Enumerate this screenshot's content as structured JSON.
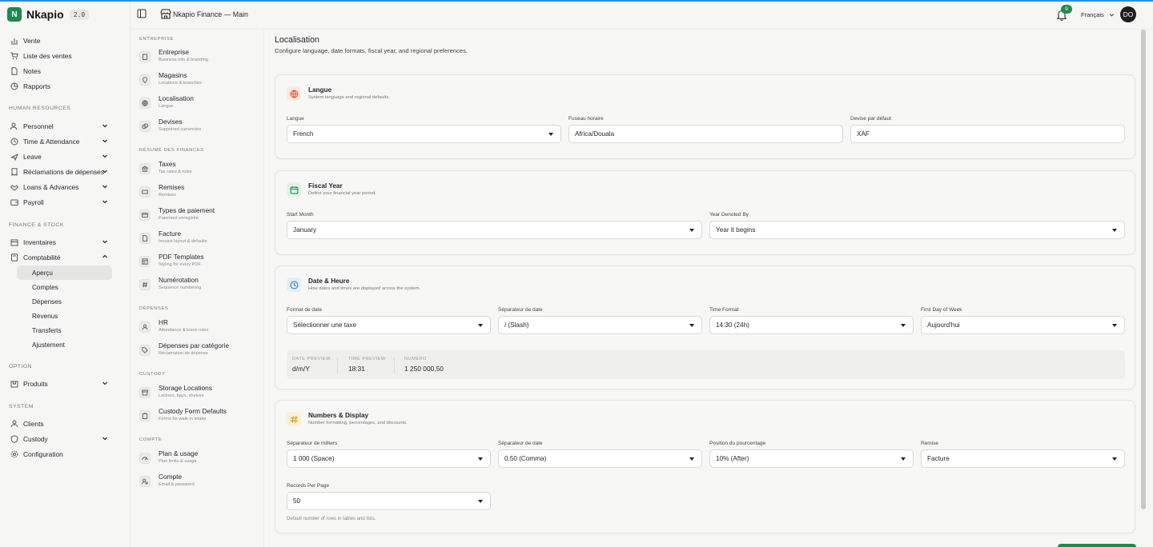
{
  "app": {
    "logo_letter": "N",
    "name": "Nkapio",
    "version": "2.0"
  },
  "header": {
    "title": "Nkapio Finance — Main",
    "notification_count": "9",
    "language": "Français",
    "avatar_initials": "DO"
  },
  "sidebar": {
    "top_items": [
      {
        "label": "Vente",
        "icon": "chart-icon"
      },
      {
        "label": "Liste des ventes",
        "icon": "cart-icon"
      },
      {
        "label": "Notes",
        "icon": "file-icon"
      },
      {
        "label": "Rapports",
        "icon": "pie-icon"
      }
    ],
    "sections": {
      "hr": "HUMAN RESOURCES",
      "finance": "FINANCE & STOCK",
      "option": "OPTION",
      "system": "SYSTEM"
    },
    "hr_items": [
      {
        "label": "Personnel",
        "icon": "users-icon"
      },
      {
        "label": "Time & Attendance",
        "icon": "clock-icon"
      },
      {
        "label": "Leave",
        "icon": "plane-icon"
      },
      {
        "label": "Réclamations de dépenses",
        "icon": "receipt-icon"
      },
      {
        "label": "Loans & Advances",
        "icon": "handshake-icon"
      },
      {
        "label": "Payroll",
        "icon": "wallet-icon"
      }
    ],
    "finance_items": [
      {
        "label": "Inventaires",
        "icon": "box-icon"
      },
      {
        "label": "Comptabilité",
        "icon": "calculator-icon"
      }
    ],
    "compta_sub": [
      "Aperçu",
      "Comptes",
      "Dépenses",
      "Revenus",
      "Transferts",
      "Ajustement"
    ],
    "option_items": [
      {
        "label": "Produits",
        "icon": "package-icon"
      }
    ],
    "system_items": [
      {
        "label": "Clients",
        "icon": "user-icon"
      },
      {
        "label": "Custody",
        "icon": "shield-icon"
      },
      {
        "label": "Configuration",
        "icon": "gear-icon"
      }
    ]
  },
  "settings_nav": {
    "sections": {
      "entreprise": "ENTREPRISE",
      "finances": "RÉSUMÉ DES FINANCES",
      "depenses": "DÉPENSES",
      "custody": "CUSTODY",
      "compte": "COMPTE"
    },
    "entreprise": [
      {
        "title": "Entreprise",
        "sub": "Business info & branding"
      },
      {
        "title": "Magasins",
        "sub": "Locations & branches"
      },
      {
        "title": "Localisation",
        "sub": "Langue"
      },
      {
        "title": "Devises",
        "sub": "Supported currencies"
      }
    ],
    "finances": [
      {
        "title": "Taxes",
        "sub": "Tax rates & rules"
      },
      {
        "title": "Remises",
        "sub": "Remises"
      },
      {
        "title": "Types de paiement",
        "sub": "Paiement enregistré"
      },
      {
        "title": "Facture",
        "sub": "Invoice layout & defaults"
      },
      {
        "title": "PDF Templates",
        "sub": "Styling for every PDF"
      },
      {
        "title": "Numérotation",
        "sub": "Sequence numbering"
      }
    ],
    "depenses": [
      {
        "title": "HR",
        "sub": "Attendance & leave rules"
      },
      {
        "title": "Dépenses par catégorie",
        "sub": "Réclamation de dépense"
      }
    ],
    "custody": [
      {
        "title": "Storage Locations",
        "sub": "Lockers, bays, shelves"
      },
      {
        "title": "Custody Form Defaults",
        "sub": "Forms for walk-in intake"
      }
    ],
    "compte": [
      {
        "title": "Plan & usage",
        "sub": "Plan limits & usage"
      },
      {
        "title": "Compte",
        "sub": "Email & password"
      }
    ]
  },
  "page": {
    "title": "Localisation",
    "subtitle": "Configure language, date formats, fiscal year, and regional preferences."
  },
  "cards": {
    "langue": {
      "title": "Langue",
      "subtitle": "System language and regional defaults.",
      "fields": [
        {
          "label": "Langue",
          "value": "French"
        },
        {
          "label": "Fuseau horaire",
          "value": "Africa/Douala"
        },
        {
          "label": "Devise par défaut",
          "value": "XAF"
        }
      ]
    },
    "fiscal": {
      "title": "Fiscal Year",
      "subtitle": "Define your financial year period.",
      "fields": [
        {
          "label": "Start Month",
          "value": "January"
        },
        {
          "label": "Year Denoted By",
          "value": "Year it begins"
        }
      ]
    },
    "date": {
      "title": "Date & Heure",
      "subtitle": "How dates and times are displayed across the system.",
      "fields": [
        {
          "label": "Format de date",
          "value": "Sélectionner une taxe"
        },
        {
          "label": "Séparateur de date",
          "value": "/ (Slash)"
        },
        {
          "label": "Time Format",
          "value": "14:30 (24h)"
        },
        {
          "label": "First Day of Week",
          "value": "Aujourd'hui"
        }
      ],
      "preview": [
        {
          "label": "DATE PREVIEW",
          "value": "d/m/Y"
        },
        {
          "label": "TIME PREVIEW",
          "value": "18:31"
        },
        {
          "label": "NUMÉRO",
          "value": "1 250 000,50"
        }
      ]
    },
    "numbers": {
      "title": "Numbers & Display",
      "subtitle": "Number formatting, percentages, and discounts.",
      "fields": [
        {
          "label": "Séparateur de milliers",
          "value": "1 000 (Space)"
        },
        {
          "label": "Séparateur de date",
          "value": "0,50 (Comma)"
        },
        {
          "label": "Position du pourcentage",
          "value": "10% (After)"
        },
        {
          "label": "Remise",
          "value": "Facture"
        },
        {
          "label": "Records Per Page",
          "value": "50"
        }
      ],
      "help": "Default number of rows in tables and lists."
    }
  },
  "colors": {
    "brand": "#1f8a4c",
    "accent_line": "#2f8fd6",
    "card_icon_red": "#e4572e",
    "card_icon_green": "#1f8a4c",
    "card_icon_blue": "#2f7fcf",
    "card_icon_amber": "#d69a1e"
  }
}
